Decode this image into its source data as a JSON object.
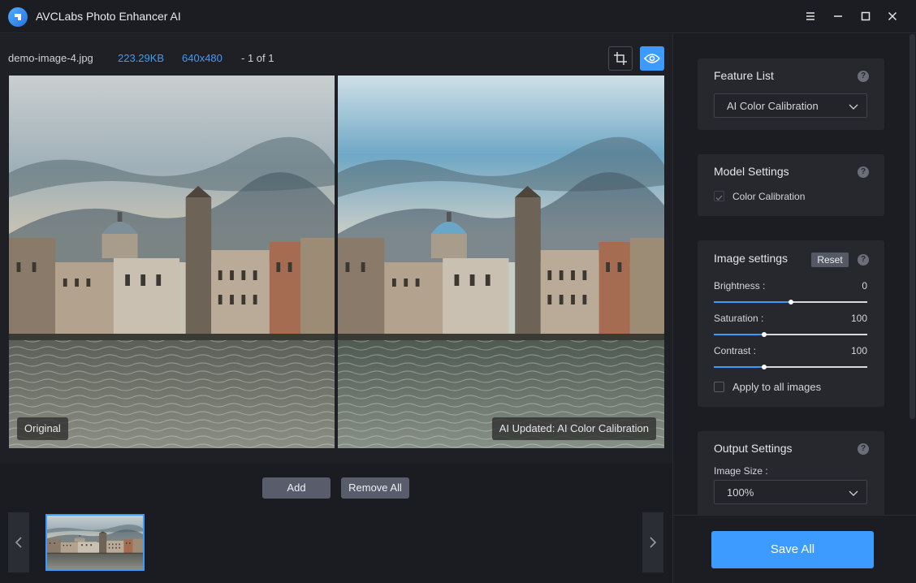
{
  "app": {
    "title": "AVCLabs Photo Enhancer AI"
  },
  "file": {
    "name": "demo-image-4.jpg",
    "size": "223.29KB",
    "dimensions": "640x480",
    "count": "- 1 of 1"
  },
  "preview": {
    "left_label": "Original",
    "right_label": "AI Updated: AI Color Calibration"
  },
  "strip": {
    "add_label": "Add",
    "remove_all_label": "Remove All"
  },
  "panel": {
    "feature_list": {
      "title": "Feature List",
      "selected": "AI Color Calibration"
    },
    "model_settings": {
      "title": "Model Settings",
      "option_label": "Color Calibration",
      "option_checked": true
    },
    "image_settings": {
      "title": "Image settings",
      "reset_label": "Reset",
      "brightness": {
        "label": "Brightness :",
        "value": "0",
        "level": 0.5
      },
      "saturation": {
        "label": "Saturation :",
        "value": "100",
        "level": 0.33
      },
      "contrast": {
        "label": "Contrast :",
        "value": "100",
        "level": 0.33
      },
      "apply_all_label": "Apply to all images"
    },
    "output_settings": {
      "title": "Output Settings",
      "size_label": "Image Size :",
      "size_value": "100%"
    },
    "save_label": "Save All",
    "help_glyph": "?"
  },
  "colors": {
    "accent": "#3d9bff",
    "panel_bg": "#26282e",
    "window_bg": "#1c1d22"
  }
}
